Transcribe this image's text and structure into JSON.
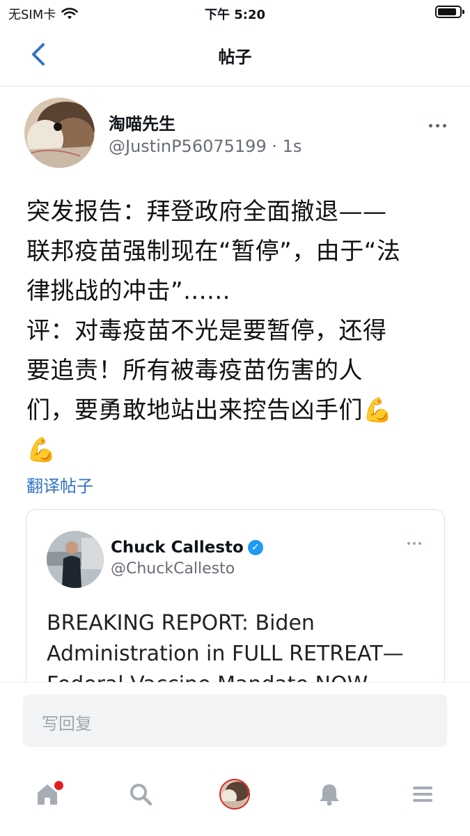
{
  "status_bar": {
    "carrier": "无SIM卡",
    "time": "下午 5:20",
    "battery_level": 0.85
  },
  "nav": {
    "title": "帖子"
  },
  "post": {
    "author_name": "淘喵先生",
    "author_handle": "@JustinP56075199 · 1s",
    "text": "突发报告：拜登政府全面撤退——\n联邦疫苗强制现在“暂停”，由于“法\n律挑战的冲击”......\n评：对毒疫苗不光是要暂停，还得\n要追责！所有被毒疫苗伤害的人\n们，要勇敢地站出来控告凶手们💪\n💪",
    "translate_label": "翻译帖子"
  },
  "quoted_tweet": {
    "author_name": "Chuck Callesto",
    "author_handle": "@ChuckCallesto",
    "text": "BREAKING REPORT: Biden Administration in FULL RETREAT—Federal Vaccine Mandate NOW"
  },
  "reply": {
    "placeholder": "写回复"
  },
  "tab_bar": {
    "icons": [
      "home-icon",
      "search-icon",
      "profile-avatar",
      "bell-icon",
      "menu-icon"
    ],
    "badge_color": "#e02020"
  }
}
